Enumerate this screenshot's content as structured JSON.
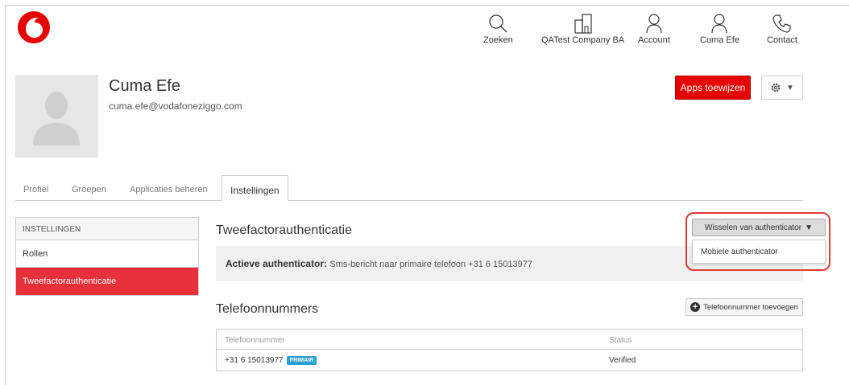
{
  "colors": {
    "brand": "#e60000",
    "active_menu": "#e7303a",
    "badge": "#2a9fd6",
    "highlight": "#e23a3a"
  },
  "topnav": [
    {
      "label": "Zoeken",
      "icon": "search-icon"
    },
    {
      "label": "QATest Company BA",
      "icon": "building-icon"
    },
    {
      "label": "Account",
      "icon": "user-icon"
    },
    {
      "label": "Cuma Efe",
      "icon": "user-icon"
    },
    {
      "label": "Contact",
      "icon": "phone-icon"
    }
  ],
  "user": {
    "name": "Cuma Efe",
    "email": "cuma.efe@vodafoneziggo.com"
  },
  "header_actions": {
    "apps_label": "Apps toewijzen",
    "gear_caret": "▼"
  },
  "tabs": [
    {
      "label": "Profiel"
    },
    {
      "label": "Groepen"
    },
    {
      "label": "Applicaties beheren"
    },
    {
      "label": "Instellingen",
      "active": true
    }
  ],
  "sidebar": {
    "header": "INSTELLINGEN",
    "items": [
      {
        "label": "Rollen"
      },
      {
        "label": "Tweefactorauthenticatie",
        "active": true
      }
    ]
  },
  "twofa": {
    "title": "Tweefactorauthenticatie",
    "active_label": "Actieve authenticator:",
    "active_value": "Sms-bericht naar primaire telefoon +31 6 15013977",
    "switch_label": "Wisselen van authenticator",
    "switch_caret": "▼",
    "dropdown_options": [
      "Mobiele authenticator"
    ]
  },
  "phones": {
    "title": "Telefoonnummers",
    "add_label": "Telefoonnummer toevoegen",
    "columns": [
      "Telefoonnummer",
      "Status"
    ],
    "rows": [
      {
        "number": "+31 6 15013977",
        "badge": "PRIMAIR",
        "status": "Verified"
      }
    ]
  }
}
